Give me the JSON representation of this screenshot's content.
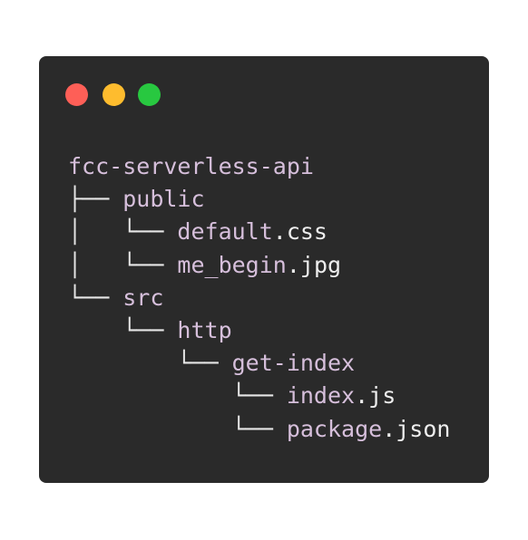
{
  "window": {
    "buttons": [
      {
        "name": "close",
        "color": "#fe5f57"
      },
      {
        "name": "minimize",
        "color": "#febc2e"
      },
      {
        "name": "maximize",
        "color": "#28c840"
      }
    ]
  },
  "tree": {
    "lines": [
      {
        "prefix": "",
        "base": "fcc-serverless-api",
        "ext": ""
      },
      {
        "prefix": "├── ",
        "base": "public",
        "ext": ""
      },
      {
        "prefix": "│   └── ",
        "base": "default",
        "ext": ".css"
      },
      {
        "prefix": "│   └── ",
        "base": "me_begin",
        "ext": ".jpg"
      },
      {
        "prefix": "└── ",
        "base": "src",
        "ext": ""
      },
      {
        "prefix": "    └── ",
        "base": "http",
        "ext": ""
      },
      {
        "prefix": "        └── ",
        "base": "get-index",
        "ext": ""
      },
      {
        "prefix": "            └── ",
        "base": "index",
        "ext": ".js"
      },
      {
        "prefix": "            └── ",
        "base": "package",
        "ext": ".json"
      }
    ]
  }
}
